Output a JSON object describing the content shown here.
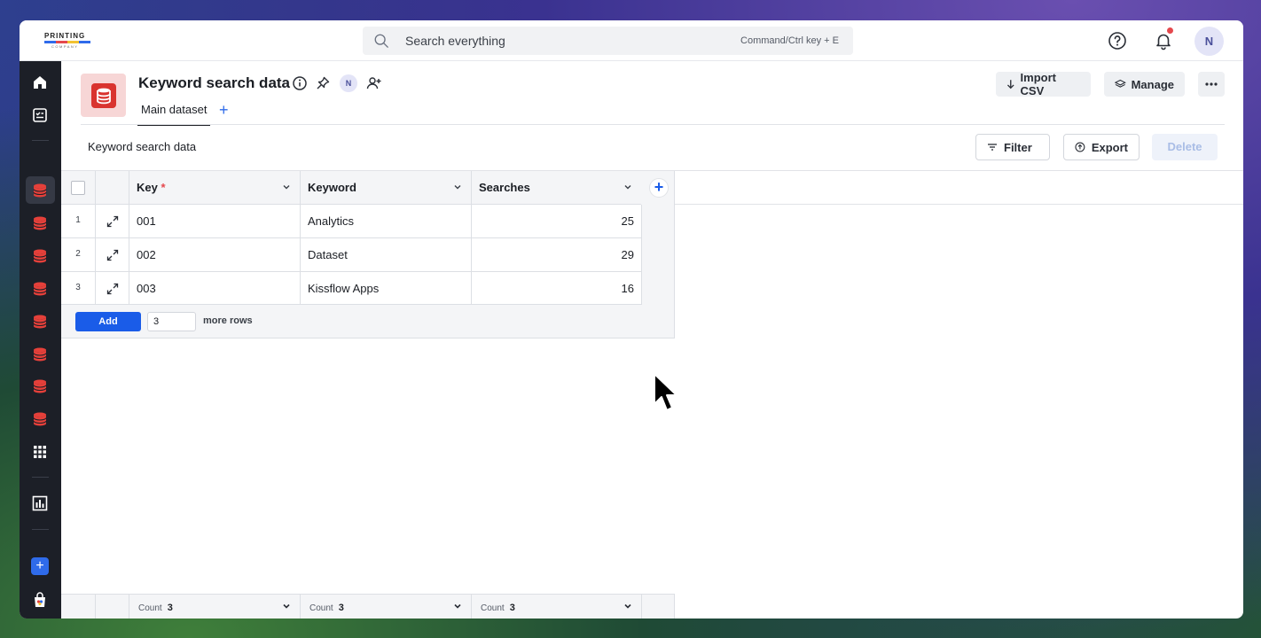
{
  "topbar": {
    "logo_text": "PRINTING",
    "logo_sub": "COMPANY",
    "search_placeholder": "Search everything",
    "search_hint": "Command/Ctrl key + E",
    "avatar_initial": "N"
  },
  "header": {
    "title": "Keyword search data",
    "avatar_initial": "N",
    "tab_label": "Main dataset",
    "tab_add": "+",
    "import_label": "Import CSV",
    "manage_label": "Manage"
  },
  "toolbar": {
    "subtitle": "Keyword search data",
    "filter_label": "Filter",
    "export_label": "Export",
    "delete_label": "Delete"
  },
  "table": {
    "columns": [
      {
        "label": "Key",
        "required_mark": "*"
      },
      {
        "label": "Keyword"
      },
      {
        "label": "Searches"
      }
    ],
    "rows": [
      {
        "num": "1",
        "key": "001",
        "keyword": "Analytics",
        "searches": "25"
      },
      {
        "num": "2",
        "key": "002",
        "keyword": "Dataset",
        "searches": "29"
      },
      {
        "num": "3",
        "key": "003",
        "keyword": "Kissflow Apps",
        "searches": "16"
      }
    ],
    "add_label": "Add",
    "add_count": "3",
    "more_rows_label": "more rows",
    "add_column": "+",
    "footer": [
      {
        "label": "Count",
        "value": "3"
      },
      {
        "label": "Count",
        "value": "3"
      },
      {
        "label": "Count",
        "value": "3"
      }
    ]
  },
  "colors": {
    "accent": "#1a5ce8",
    "dataset_red": "#d9342f",
    "sidebar_bg": "#1c1f27"
  }
}
